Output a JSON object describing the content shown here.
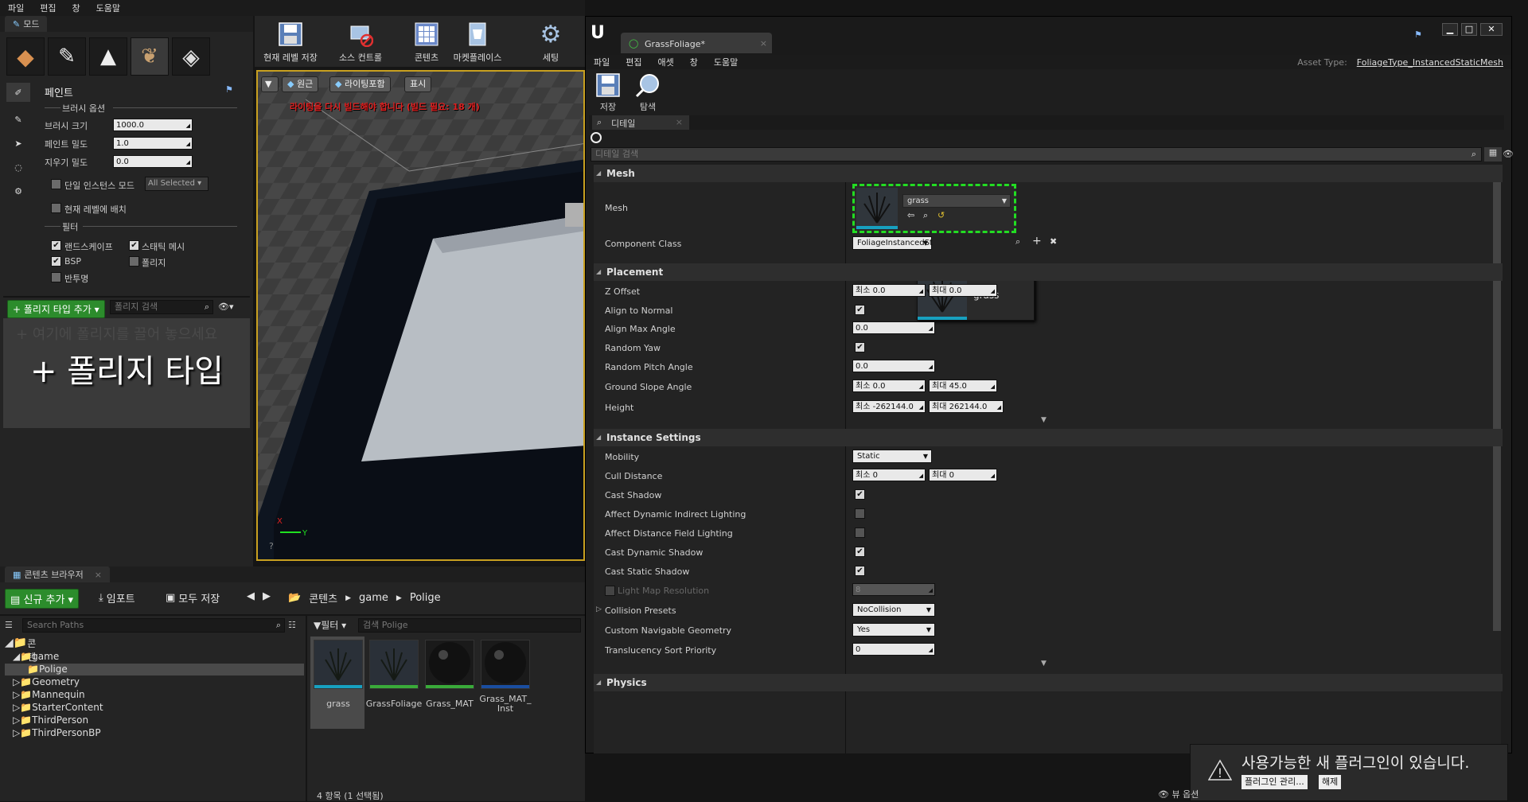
{
  "main_menu": [
    "파일",
    "편집",
    "창",
    "도움말"
  ],
  "modes_panel": {
    "tab": "모드",
    "section_title": "페인트",
    "brush_options_label": "브러시 옵션",
    "brush_size_label": "브러시 크기",
    "brush_size_value": "1000.0",
    "paint_density_label": "페인트 밀도",
    "paint_density_value": "1.0",
    "erase_density_label": "지우기 밀도",
    "erase_density_value": "0.0",
    "single_instance_label": "단일 인스턴스 모드",
    "single_instance_dropdown": "All Selected",
    "place_current_level_label": "현재 레벨에 배치",
    "filter_label": "필터",
    "filter_landscape": "랜드스케이프",
    "filter_static_mesh": "스태틱 메시",
    "filter_bsp": "BSP",
    "filter_foliage": "폴리지",
    "filter_translucent": "반투명",
    "add_foliage_type_button": "폴리지 타입 추가",
    "foliage_search_placeholder": "폴리지 검색",
    "drop_hint": "+ 여기에 폴리지를 끌어 놓으세요",
    "drop_big_label": "+ 폴리지 타입"
  },
  "toolbar": {
    "save_current_level": "현재 레벨 저장",
    "source_control": "소스 컨트롤",
    "content": "콘텐츠",
    "marketplace": "마켓플레이스",
    "settings": "세팅"
  },
  "viewport": {
    "perspective_button": "원근",
    "lighting_button": "라이팅포함",
    "show_button": "표시",
    "warning_text": "라이팅을 다시 빌드해야 합니다 (빌드 필요: 18 개)",
    "axis_x": "X",
    "axis_y": "Y"
  },
  "content_browser": {
    "tab": "콘텐츠 브라우저",
    "add_new_button": "신규 추가",
    "import_button": "임포트",
    "save_all_button": "모두 저장",
    "breadcrumb": [
      "콘텐츠",
      "game",
      "Polige"
    ],
    "search_paths_placeholder": "Search Paths",
    "filter_button": "필터",
    "search_placeholder": "검색 Polige",
    "tree": [
      {
        "label": "콘텐츠",
        "level": 0
      },
      {
        "label": "game",
        "level": 1
      },
      {
        "label": "Polige",
        "level": 2,
        "selected": true
      },
      {
        "label": "Geometry",
        "level": 1
      },
      {
        "label": "Mannequin",
        "level": 1
      },
      {
        "label": "StarterContent",
        "level": 1
      },
      {
        "label": "ThirdPerson",
        "level": 1
      },
      {
        "label": "ThirdPersonBP",
        "level": 1
      }
    ],
    "assets": [
      {
        "label": "grass",
        "kind": "mesh",
        "bar": "#17a0c0"
      },
      {
        "label": "GrassFoliage",
        "kind": "mesh",
        "bar": "#3aaa3a"
      },
      {
        "label": "Grass_MAT",
        "kind": "sphere",
        "bar": "#3aaa3a"
      },
      {
        "label": "Grass_MAT_\nInst",
        "kind": "sphere",
        "bar": "#1a4ea0"
      }
    ],
    "status": "4 항목 (1 선택됨)",
    "view_options": "뷰 옵션"
  },
  "editor": {
    "tab_title": "GrassFoliage*",
    "menu": [
      "파일",
      "편집",
      "애셋",
      "창",
      "도움말"
    ],
    "asset_type_label": "Asset Type:",
    "asset_type_value": "FoliageType_InstancedStaticMesh",
    "save_label": "저장",
    "browse_label": "탐색",
    "details_tab": "디테일",
    "details_search_placeholder": "디테일 검색",
    "mesh_category": "Mesh",
    "mesh_label": "Mesh",
    "mesh_value": "grass",
    "component_class_label": "Component Class",
    "component_class_value": "FoliageInstancedSt",
    "tooltip_label": "grass",
    "placement_category": "Placement",
    "z_offset_label": "Z Offset",
    "z_offset_min": "0.0",
    "z_offset_max": "0.0",
    "min_prefix": "최소",
    "max_prefix": "최대",
    "align_to_normal_label": "Align to Normal",
    "align_max_angle_label": "Align Max Angle",
    "align_max_angle_value": "0.0",
    "random_yaw_label": "Random Yaw",
    "random_pitch_label": "Random Pitch Angle",
    "random_pitch_value": "0.0",
    "ground_slope_label": "Ground Slope Angle",
    "ground_slope_min": "0.0",
    "ground_slope_max": "45.0",
    "height_label": "Height",
    "height_min": "-262144.0",
    "height_max": "262144.0",
    "instance_category": "Instance Settings",
    "mobility_label": "Mobility",
    "mobility_value": "Static",
    "cull_distance_label": "Cull Distance",
    "cull_min": "0",
    "cull_max": "0",
    "cast_shadow_label": "Cast Shadow",
    "affect_dyn_indirect_label": "Affect Dynamic Indirect Lighting",
    "affect_distance_field_label": "Affect Distance Field Lighting",
    "cast_dynamic_shadow_label": "Cast Dynamic Shadow",
    "cast_static_shadow_label": "Cast Static Shadow",
    "light_map_res_label": "Light Map Resolution",
    "light_map_res_value": "8",
    "collision_presets_label": "Collision Presets",
    "collision_presets_value": "NoCollision",
    "custom_nav_label": "Custom Navigable Geometry",
    "custom_nav_value": "Yes",
    "translucency_label": "Translucency Sort Priority",
    "translucency_value": "0",
    "physics_category": "Physics"
  },
  "notification": {
    "text": "사용가능한 새 플러그인이 있습니다.",
    "manage_button": "플러그인 관리...",
    "dismiss_button": "해제"
  },
  "colors": {
    "accent_green": "#2c8c2c",
    "viewport_border": "#c8a020",
    "mesh_highlight": "#22dd22",
    "warning_red": "#e02020"
  }
}
